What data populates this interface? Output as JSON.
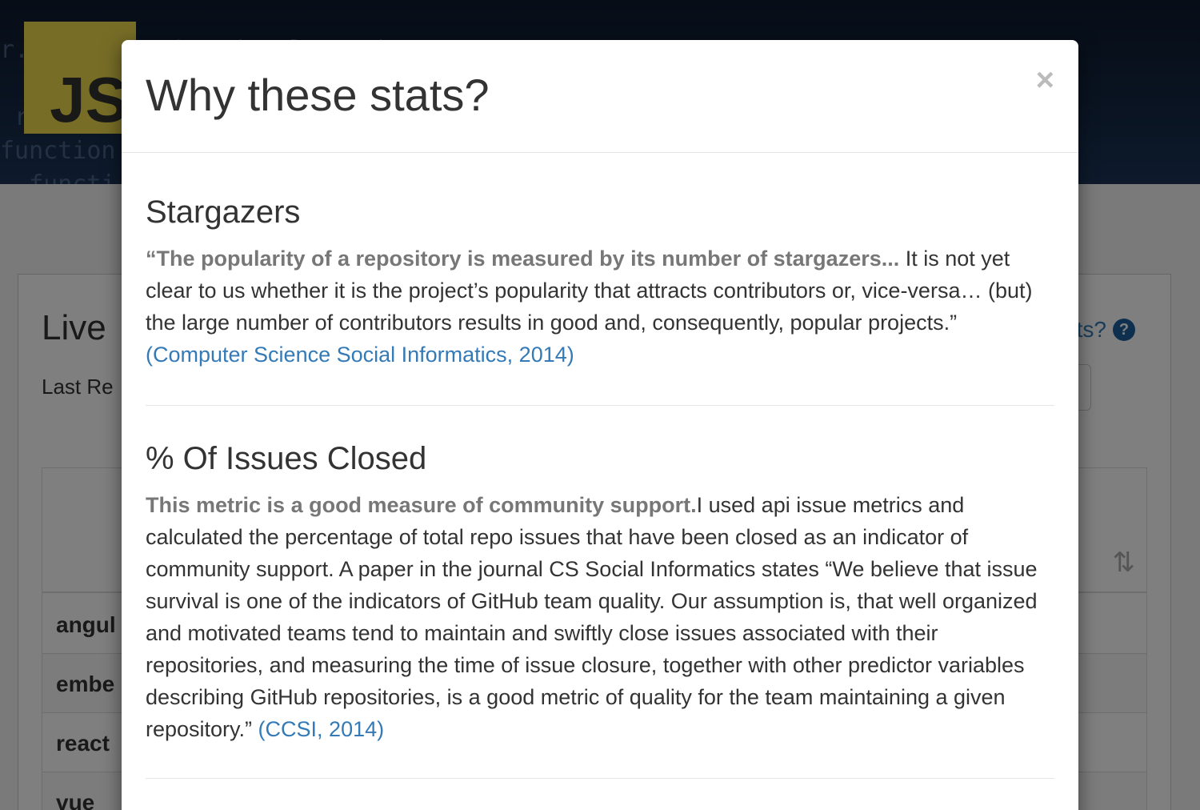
{
  "background": {
    "logo_text": "JS",
    "page_heading": "Live",
    "last_refreshed_label": "Last Re",
    "why_link_label": "ats?",
    "rows": [
      {
        "name": "angul"
      },
      {
        "name": "embe"
      },
      {
        "name": "react"
      },
      {
        "name": "vue"
      }
    ]
  },
  "modal": {
    "title": "Why these stats?",
    "close_label": "×",
    "sections": [
      {
        "heading": "Stargazers",
        "lead": "“The popularity of a repository is measured by its number of stargazers...",
        "body": " It is not yet clear to us whether it is the project’s popularity that attracts contributors or, vice-versa… (but) the large number of contributors results in good and, consequently, popular projects.” ",
        "citation": "(Computer Science Social Informatics, 2014)"
      },
      {
        "heading": "% Of Issues Closed",
        "lead": "This metric is a good measure of community support.",
        "body": "I used api issue metrics and calculated the percentage of total repo issues that have been closed as an indicator of community support. A paper in the journal CS Social Informatics states “We believe that issue survival is one of the indicators of GitHub team quality. Our assumption is, that well organized and motivated teams tend to maintain and swiftly close issues associated with their repositories, and measuring the time of issue closure, together with other predictor variables describing GitHub repositories, is a good metric of quality for the team maintaining a given repository.” ",
        "citation": "(CCSI, 2014)"
      }
    ]
  },
  "colors": {
    "link": "#337ab7",
    "js_logo": "#f0db4f",
    "backdrop": "rgba(0,0,0,0.5)"
  },
  "icons": {
    "help": "question-circle-icon",
    "sort": "sort-icon",
    "close": "close-icon"
  }
}
